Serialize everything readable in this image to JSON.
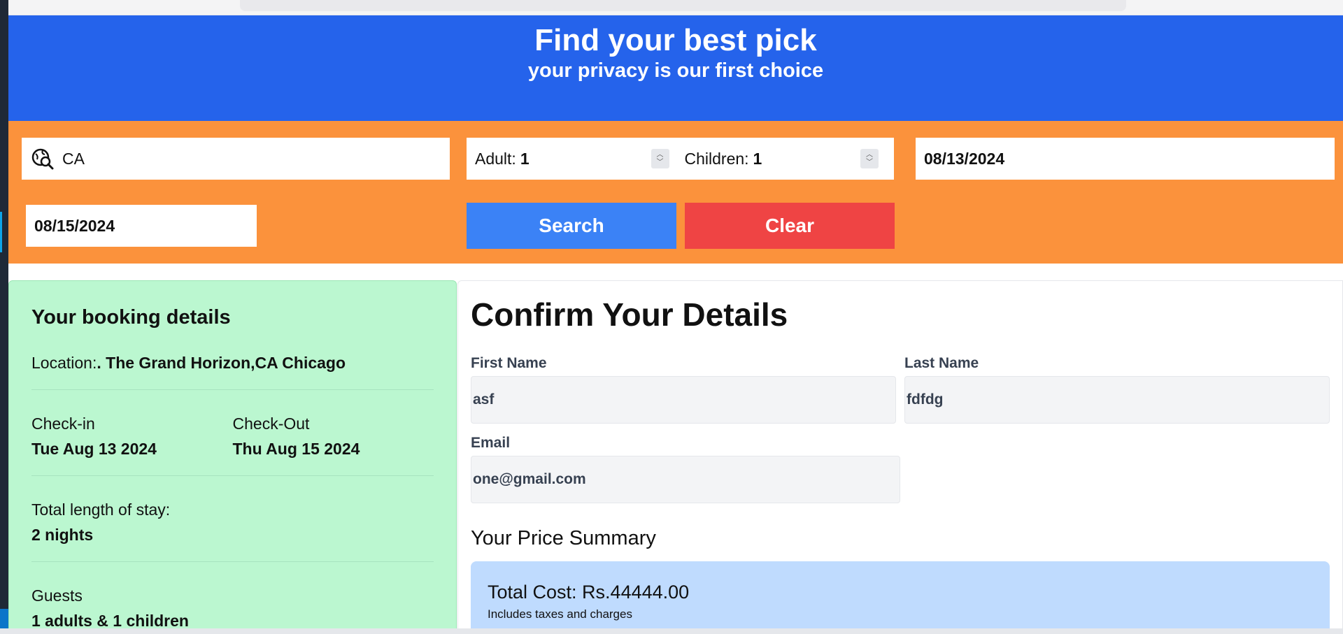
{
  "header": {
    "title": "Find your best pick",
    "subtitle": "your privacy is our first choice"
  },
  "search": {
    "location_value": "CA",
    "adult_label": "Adult:",
    "adult_value": "1",
    "children_label": "Children:",
    "children_value": "1",
    "checkin_date": "08/13/2024",
    "checkout_date": "08/15/2024",
    "search_label": "Search",
    "clear_label": "Clear"
  },
  "booking": {
    "title": "Your booking details",
    "location_label": "Location:",
    "location_value": ". The Grand Horizon,CA Chicago",
    "checkin_label": "Check-in",
    "checkin_value": "Tue Aug 13 2024",
    "checkout_label": "Check-Out",
    "checkout_value": "Thu Aug 15 2024",
    "stay_label": "Total length of stay:",
    "stay_value": "2 nights",
    "guests_label": "Guests",
    "guests_value": "1 adults & 1 children"
  },
  "confirm": {
    "title": "Confirm Your Details",
    "first_name_label": "First Name",
    "first_name_value": "asf",
    "last_name_label": "Last Name",
    "last_name_value": "fdfdg",
    "email_label": "Email",
    "email_value": "one@gmail.com",
    "price_title": "Your Price Summary",
    "total_cost": "Total Cost: Rs.44444.00",
    "total_note": "Includes taxes and charges"
  },
  "colors": {
    "header_bg": "#2563eb",
    "search_bg": "#fb923c",
    "search_button": "#3b82f6",
    "clear_button": "#ef4444",
    "details_bg": "#bbf7d0",
    "price_bg": "#bfdbfe"
  }
}
